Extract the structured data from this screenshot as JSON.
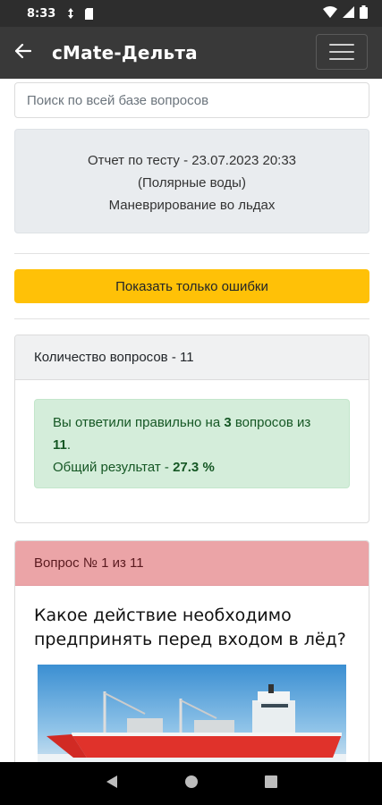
{
  "status_bar": {
    "time": "8:33"
  },
  "app_bar": {
    "title": "cMate-Дельта"
  },
  "search": {
    "placeholder": "Поиск по всей базе вопросов",
    "value": ""
  },
  "report": {
    "line1": "Отчет по тесту - 23.07.2023 20:33",
    "line2": "(Полярные воды)",
    "line3": "Маневрирование во льдах"
  },
  "actions": {
    "show_errors_label": "Показать только ошибки"
  },
  "summary": {
    "header": "Количество вопросов - 11",
    "answered_prefix": "Вы ответили правильно на ",
    "correct_count": "3",
    "answered_mid": " вопросов из ",
    "total_count": "11",
    "answered_suffix": ".",
    "result_prefix": "Общий результат - ",
    "result_value": "27.3 %"
  },
  "question": {
    "header": "Вопрос № 1 из 11",
    "text": "Какое действие необходимо предпринять перед входом в лёд?"
  },
  "colors": {
    "warning": "#ffc107",
    "success_bg": "#d4edda",
    "danger_header": "#eba4a7",
    "app_bar": "#393939"
  },
  "icons": {
    "back": "arrow-left-icon",
    "menu": "hamburger-menu-icon",
    "nav_back": "triangle-back-icon",
    "nav_home": "circle-home-icon",
    "nav_recents": "square-recents-icon"
  }
}
